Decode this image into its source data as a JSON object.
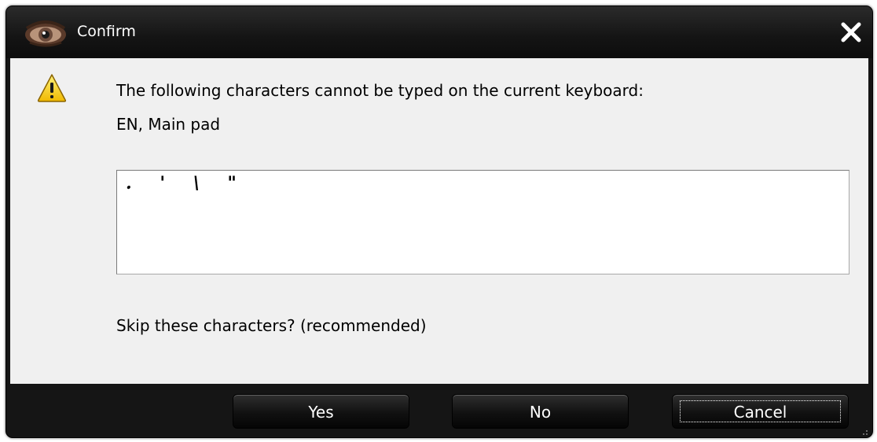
{
  "window": {
    "title": "Confirm",
    "app_icon": "eye-icon",
    "close_icon": "close-icon"
  },
  "message": {
    "icon": "warning-icon",
    "line1": "The following characters cannot be typed on the current keyboard:",
    "line2": "EN, Main pad"
  },
  "characters_box": {
    "value": ". ' \\ \""
  },
  "question": "Skip these characters? (recommended)",
  "buttons": {
    "yes": "Yes",
    "no": "No",
    "cancel": "Cancel",
    "focused": "cancel"
  },
  "colors": {
    "title_bar": "#141414",
    "content_bg": "#f0f0f0",
    "button_bg": "#111111",
    "warning_yellow": "#f5c400"
  }
}
